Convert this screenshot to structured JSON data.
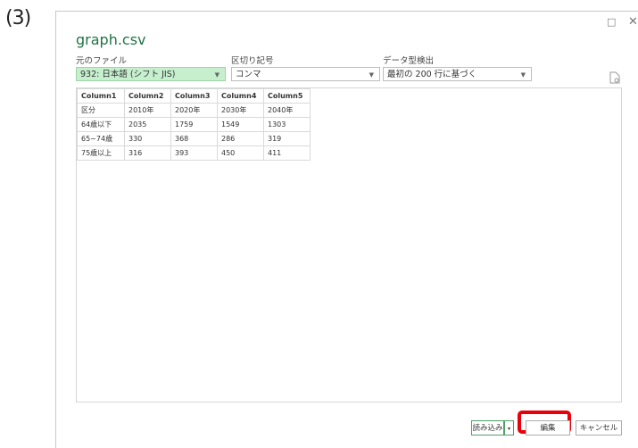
{
  "step_label": "(3)",
  "window": {
    "maximize_icon": "□",
    "close_icon": "✕"
  },
  "file_title": "graph.csv",
  "fields": {
    "origin": {
      "label": "元のファイル",
      "value": "932: 日本語 (シフト JIS)"
    },
    "delimiter": {
      "label": "区切り記号",
      "value": "コンマ"
    },
    "detection": {
      "label": "データ型検出",
      "value": "最初の 200 行に基づく"
    }
  },
  "table": {
    "headers": [
      "Column1",
      "Column2",
      "Column3",
      "Column4",
      "Column5"
    ],
    "rows": [
      [
        "区分",
        "2010年",
        "2020年",
        "2030年",
        "2040年"
      ],
      [
        "64歳以下",
        "2035",
        "1759",
        "1549",
        "1303"
      ],
      [
        "65~74歳",
        "330",
        "368",
        "286",
        "319"
      ],
      [
        "75歳以上",
        "316",
        "393",
        "450",
        "411"
      ]
    ]
  },
  "buttons": {
    "load": "読み込み",
    "load_arrow": "▾",
    "edit": "編集",
    "cancel": "キャンセル"
  },
  "icons": {
    "file_settings": "file-settings-icon"
  },
  "colors": {
    "title": "#217346",
    "highlight": "#e8000b",
    "active_field": "#c6efce"
  }
}
